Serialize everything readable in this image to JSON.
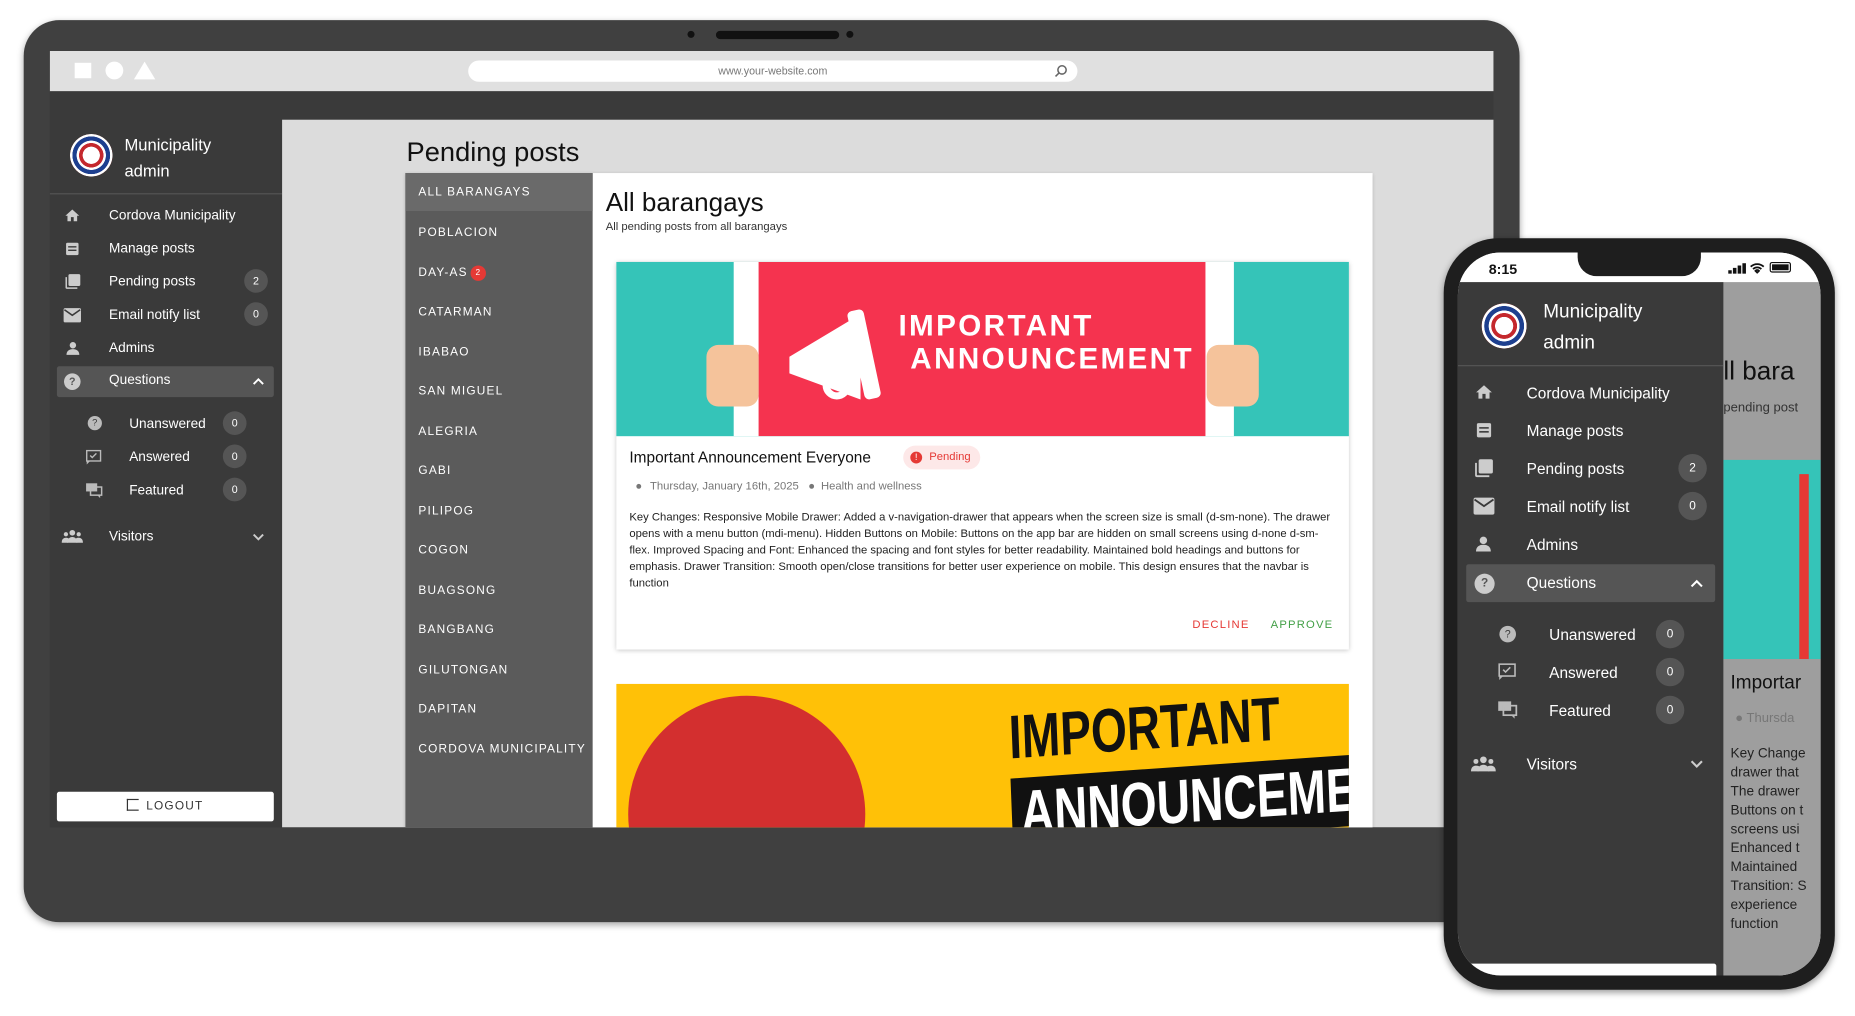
{
  "browser": {
    "url": "www.your-website.com"
  },
  "sidebar": {
    "title_line1": "Municipality",
    "title_line2": "admin",
    "items": [
      {
        "label": "Cordova Municipality",
        "icon": "home-icon"
      },
      {
        "label": "Manage posts",
        "icon": "list-icon"
      },
      {
        "label": "Pending posts",
        "icon": "copy-icon",
        "badge": "2"
      },
      {
        "label": "Email notify list",
        "icon": "mail-icon",
        "badge": "0"
      },
      {
        "label": "Admins",
        "icon": "person-icon"
      }
    ],
    "questions": {
      "label": "Questions",
      "children": [
        {
          "label": "Unanswered",
          "badge": "0"
        },
        {
          "label": "Answered",
          "badge": "0"
        },
        {
          "label": "Featured",
          "badge": "0"
        }
      ]
    },
    "visitors": "Visitors",
    "logout": "LOGOUT"
  },
  "main": {
    "page_title": "Pending posts",
    "tabs": [
      "ALL BARANGAYS",
      "POBLACION",
      "DAY-AS",
      "CATARMAN",
      "IBABAO",
      "SAN MIGUEL",
      "ALEGRIA",
      "GABI",
      "PILIPOG",
      "COGON",
      "BUAGSONG",
      "BANGBANG",
      "GILUTONGAN",
      "DAPITAN",
      "CORDOVA MUNICIPALITY"
    ],
    "dayas_badge": "2",
    "heading": "All barangays",
    "subheading": "All pending posts from all barangays",
    "post": {
      "banner_line1": "IMPORTANT",
      "banner_line2": "ANNOUNCEMENT",
      "title": "Important Announcement Everyone",
      "status": "Pending",
      "date": "Thursday, January 16th, 2025",
      "category": "Health and wellness",
      "body": "Key Changes: Responsive Mobile Drawer: Added a v-navigation-drawer that appears when the screen size is small (d-sm-none). The drawer opens with a menu button (mdi-menu). Hidden Buttons on Mobile: Buttons on the app bar are hidden on small screens using d-none d-sm-flex. Improved Spacing and Font: Enhanced the spacing and font styles for better readability. Maintained bold headings and buttons for emphasis. Drawer Transition: Smooth open/close transitions for better user experience on mobile. This design ensures that the navbar is function",
      "decline": "DECLINE",
      "approve": "APPROVE"
    },
    "post2": {
      "banner_line1": "IMPORTANT",
      "banner_line2": "ANNOUNCEMENT"
    }
  },
  "phone": {
    "time": "8:15",
    "peek_heading": "ll bara",
    "peek_sub": "pending post",
    "peek_title": "Importar",
    "peek_date": "Thursda",
    "peek_lines": [
      "Key Change",
      "drawer that",
      "The drawer",
      "Buttons on t",
      "screens usi",
      "Enhanced t",
      "Maintained",
      "Transition: S",
      "experience",
      "function"
    ]
  },
  "colors": {
    "sidebar": "#3a3a3a",
    "tabs": "#5b5b5b",
    "decline": "#e53935",
    "approve": "#43a047",
    "pending_badge": "#e53935",
    "banner_red": "#f5334f",
    "banner_teal": "#35c4b8",
    "banner_yellow": "#ffc107"
  }
}
